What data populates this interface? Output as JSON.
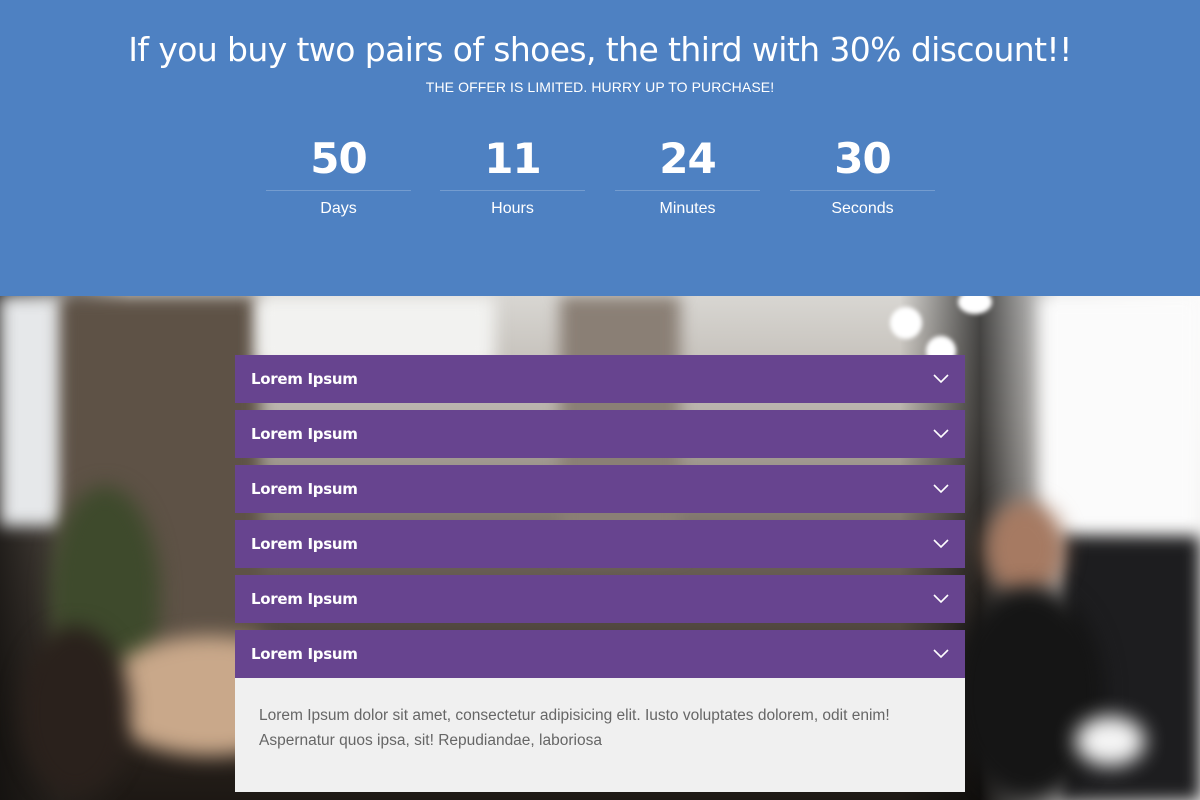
{
  "promo": {
    "title": "If you buy two pairs of shoes, the third with 30% discount!!",
    "subtitle": "THE OFFER IS LIMITED. HURRY UP TO PURCHASE!",
    "background_color": "#4e81c2",
    "countdown": {
      "days": {
        "value": "50",
        "label": "Days"
      },
      "hours": {
        "value": "11",
        "label": "Hours"
      },
      "minutes": {
        "value": "24",
        "label": "Minutes"
      },
      "seconds": {
        "value": "30",
        "label": "Seconds"
      }
    }
  },
  "accordion": {
    "header_color": "#67448f",
    "items": [
      {
        "title": "Lorem Ipsum",
        "icon": "chevron-down-icon"
      },
      {
        "title": "Lorem Ipsum",
        "icon": "chevron-down-icon"
      },
      {
        "title": "Lorem Ipsum",
        "icon": "chevron-down-icon"
      },
      {
        "title": "Lorem Ipsum",
        "icon": "chevron-down-icon"
      },
      {
        "title": "Lorem Ipsum",
        "icon": "chevron-down-icon"
      },
      {
        "title": "Lorem Ipsum",
        "icon": "chevron-down-icon",
        "expanded": true,
        "content": "Lorem Ipsum dolor sit amet, consectetur adipisicing elit. Iusto voluptates dolorem, odit enim! Aspernatur quos ipsa, sit! Repudiandae, laboriosa"
      }
    ]
  }
}
